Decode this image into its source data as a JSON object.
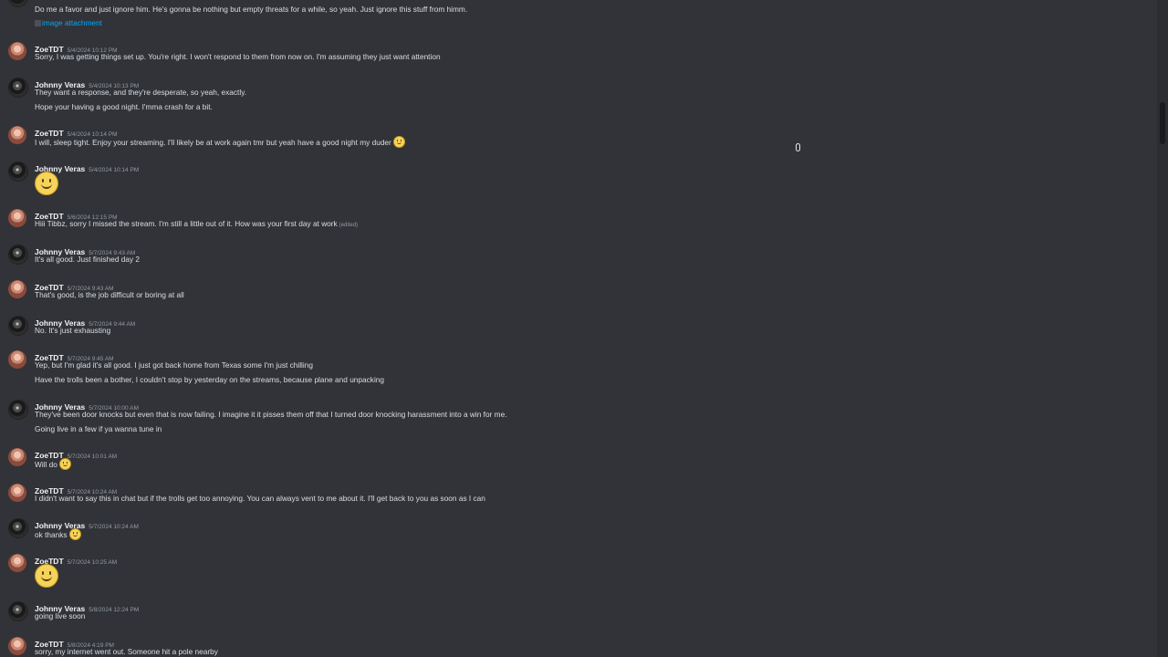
{
  "messages": [
    {
      "author": "",
      "timestamp": "",
      "lines": [
        "Do me a favor and just ignore him. He's gonna be nothing but empty threats for a while, so yeah. Just ignore this stuff from himm."
      ],
      "attachment": "image attachment"
    },
    {
      "author": "ZoeTDT",
      "timestamp": "5/4/2024 10:12 PM",
      "lines": [
        "Sorry, I was getting things set up. You're right. I won't respond to them from now on. I'm assuming they just want attention"
      ]
    },
    {
      "author": "Johnny Veras",
      "timestamp": "5/4/2024 10:13 PM",
      "lines": [
        "They want a response, and they're desperate, so yeah, exactly.",
        "Hope your having a good night. I'mma crash for a bit."
      ]
    },
    {
      "author": "ZoeTDT",
      "timestamp": "5/4/2024 10:14 PM",
      "lines": [
        "I will, sleep tight. Enjoy your streaming. I'll likely be at work again tmr but yeah have a good night my duder"
      ]
    },
    {
      "author": "Johnny Veras",
      "timestamp": "5/4/2024 10:14 PM",
      "lines": []
    },
    {
      "author": "ZoeTDT",
      "timestamp": "5/6/2024 12:15 PM",
      "lines": [
        "Hiii Tibbz, sorry I missed the stream. I'm still a little out of it. How was your first day at work"
      ],
      "edited": "(edited)"
    },
    {
      "author": "Johnny Veras",
      "timestamp": "5/7/2024 9:43 AM",
      "lines": [
        "It's all good. Just finished day 2"
      ]
    },
    {
      "author": "ZoeTDT",
      "timestamp": "5/7/2024 9:43 AM",
      "lines": [
        "That's good, is the job difficult or boring at all"
      ]
    },
    {
      "author": "Johnny Veras",
      "timestamp": "5/7/2024 9:44 AM",
      "lines": [
        "No. It's just exhausting"
      ]
    },
    {
      "author": "ZoeTDT",
      "timestamp": "5/7/2024 9:45 AM",
      "lines": [
        "Yep, but I'm glad it's all good. I just got back home from Texas some I'm just chilling",
        "Have the trolls been a bother, I couldn't stop by yesterday on the streams, because plane and unpacking"
      ]
    },
    {
      "author": "Johnny Veras",
      "timestamp": "5/7/2024 10:00 AM",
      "lines": [
        "They've been door knocks but even that is now failing. I imagine it it pisses them off that I turned door knocking harassment into a win for me.",
        "Going live in a few if ya wanna tune in"
      ]
    },
    {
      "author": "ZoeTDT",
      "timestamp": "5/7/2024 10:01 AM",
      "lines": [
        "Will do"
      ]
    },
    {
      "author": "ZoeTDT",
      "timestamp": "5/7/2024 10:24 AM",
      "lines": [
        "I didn't want to say this in chat but if the trolls get too annoying. You can always vent to me about it. I'll get back to you as soon as I can"
      ]
    },
    {
      "author": "Johnny Veras",
      "timestamp": "5/7/2024 10:24 AM",
      "lines": [
        "ok thanks"
      ]
    },
    {
      "author": "ZoeTDT",
      "timestamp": "5/7/2024 10:25 AM",
      "lines": []
    },
    {
      "author": "Johnny Veras",
      "timestamp": "5/8/2024 12:24 PM",
      "lines": [
        "going live soon"
      ]
    },
    {
      "author": "ZoeTDT",
      "timestamp": "5/8/2024 4:19 PM",
      "lines": [
        "sorry, my internet went out. Someone hit a pole nearby"
      ]
    }
  ],
  "icons": {
    "emoji": "slightly-smiling-face",
    "avatar_zoe": "avatar-zoetdt",
    "avatar_johnny": "avatar-johnny-veras"
  }
}
